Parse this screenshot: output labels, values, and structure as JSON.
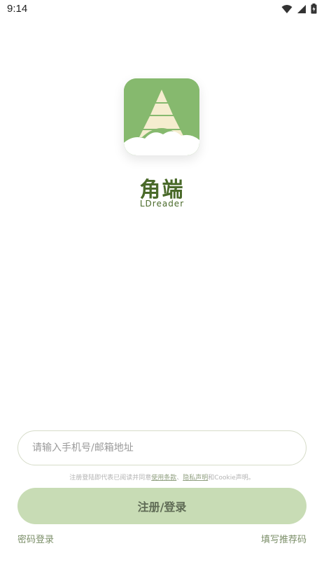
{
  "status_bar": {
    "time": "9:14",
    "icons": [
      "wifi-icon",
      "signal-icon",
      "battery-charging-icon"
    ]
  },
  "brand": {
    "name_cn": "角端",
    "name_en": "LDreader",
    "color": "#4a6a2a",
    "logo_color": "#86b96e"
  },
  "login": {
    "input_placeholder": "请输入手机号/邮箱地址",
    "input_value": "",
    "agreement_prefix": "注册登陆即代表已阅读并同意",
    "terms_link": "使用条款",
    "separator": "、",
    "privacy_link": "隐私声明",
    "cookie_text": "和Cookie声明。",
    "submit_label": "注册/登录",
    "password_login": "密码登录",
    "invite_code": "填写推荐码",
    "accent_color": "#c8dcb5"
  }
}
